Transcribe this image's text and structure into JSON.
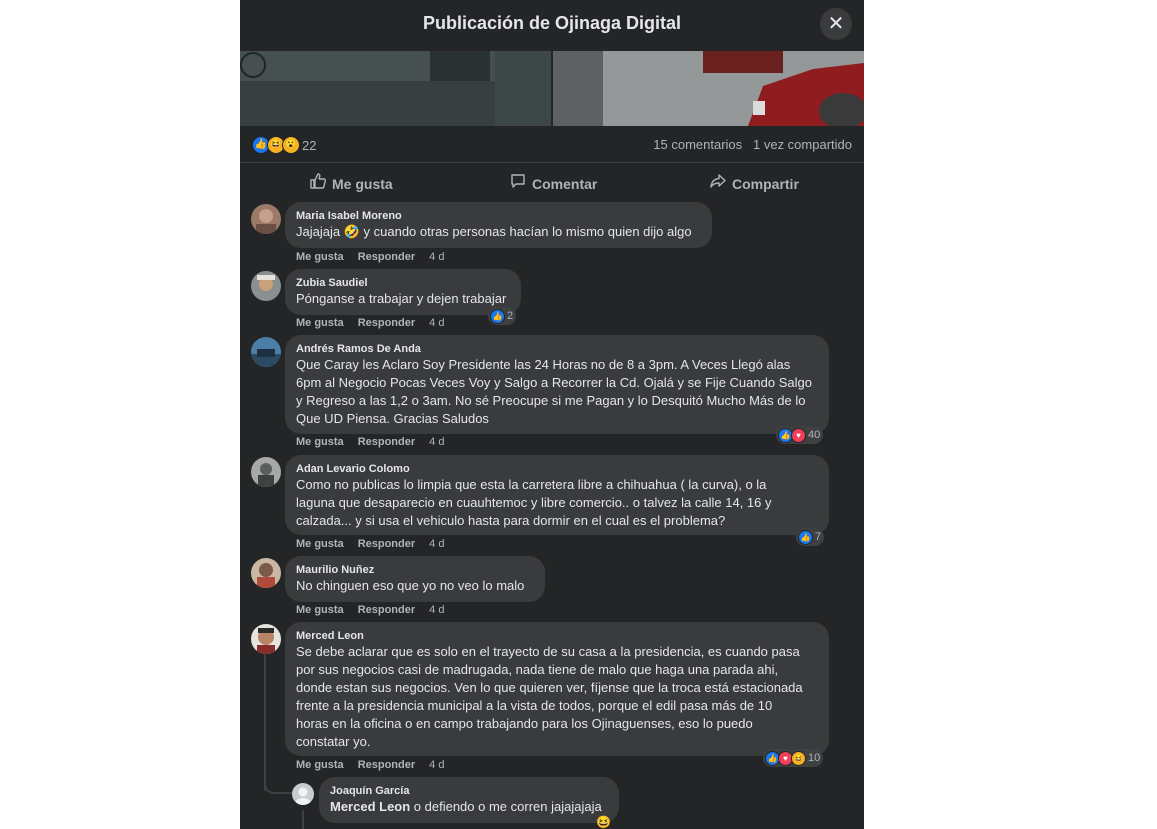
{
  "header": {
    "title": "Publicación de Ojinaga Digital",
    "close_icon": "close-icon"
  },
  "post_stats": {
    "reaction_icons": [
      "like-icon",
      "haha-icon",
      "wow-icon"
    ],
    "reaction_count": "22",
    "comments": "15 comentarios",
    "shares": "1 vez compartido"
  },
  "actions": {
    "like": "Me gusta",
    "comment": "Comentar",
    "share": "Compartir"
  },
  "labels": {
    "like": "Me gusta",
    "reply": "Responder"
  },
  "comments": [
    {
      "name": "Maria Isabel Moreno",
      "text_before": "Jajajaja",
      "emoji": "🤣",
      "text_after": " y cuando otras personas hacían lo mismo quien dijo algo",
      "time": "4 d"
    },
    {
      "name": "Zubia Saudiel",
      "text": "Pónganse a trabajar y dejen trabajar",
      "time": "4 d",
      "reactions": "2"
    },
    {
      "name": "Andrés Ramos De Anda",
      "lines": [
        "Que Caray les Aclaro Soy Presidente las 24 Horas no de 8 a 3pm. A Veces Llegó alas",
        "6pm al Negocio Pocas Veces Voy y Salgo a Recorrer la Cd. Ojalá y se Fije Cuando Salgo",
        "y Regreso a las 1,2 o 3am. No sé Preocupe si me Pagan y lo Desquitó Mucho Más de lo",
        "Que UD Piensa. Gracias Saludos"
      ],
      "time": "4 d",
      "reactions": "40"
    },
    {
      "name": "Adan Levario Colomo",
      "lines": [
        "Como no publicas lo limpia que esta la carretera libre a chihuahua ( la curva), o la",
        "laguna que desaparecio en cuauhtemoc y libre comercio.. o talvez la calle 14, 16 y",
        "calzada... y si usa el vehiculo hasta para dormir en el cual es el problema?"
      ],
      "time": "4 d",
      "reactions": "7"
    },
    {
      "name": "Maurilio Nuñez",
      "text": "No chinguen eso que yo no veo lo malo",
      "time": "4 d"
    },
    {
      "name": "Merced Leon",
      "lines": [
        "Se debe aclarar que es solo en el trayecto de su casa a la presidencia, es cuando pasa",
        "por sus negocios casi de madrugada, nada tiene de malo que haga una parada ahi,",
        "donde estan sus negocios. Ven lo que quieren ver, fíjense que la troca está estacionada",
        "frente a la presidencia municipal a la vista de todos, porque el edil pasa más de 10",
        "horas en la oficina o en campo trabajando para los Ojinaguenses, eso lo puedo",
        "constatar yo."
      ],
      "time": "4 d",
      "reactions": "10"
    }
  ],
  "reply": {
    "name": "Joaquín García",
    "mention": "Merced Leon",
    "text": " o defiendo o me corren jajajajaja",
    "emoji": "😆"
  }
}
